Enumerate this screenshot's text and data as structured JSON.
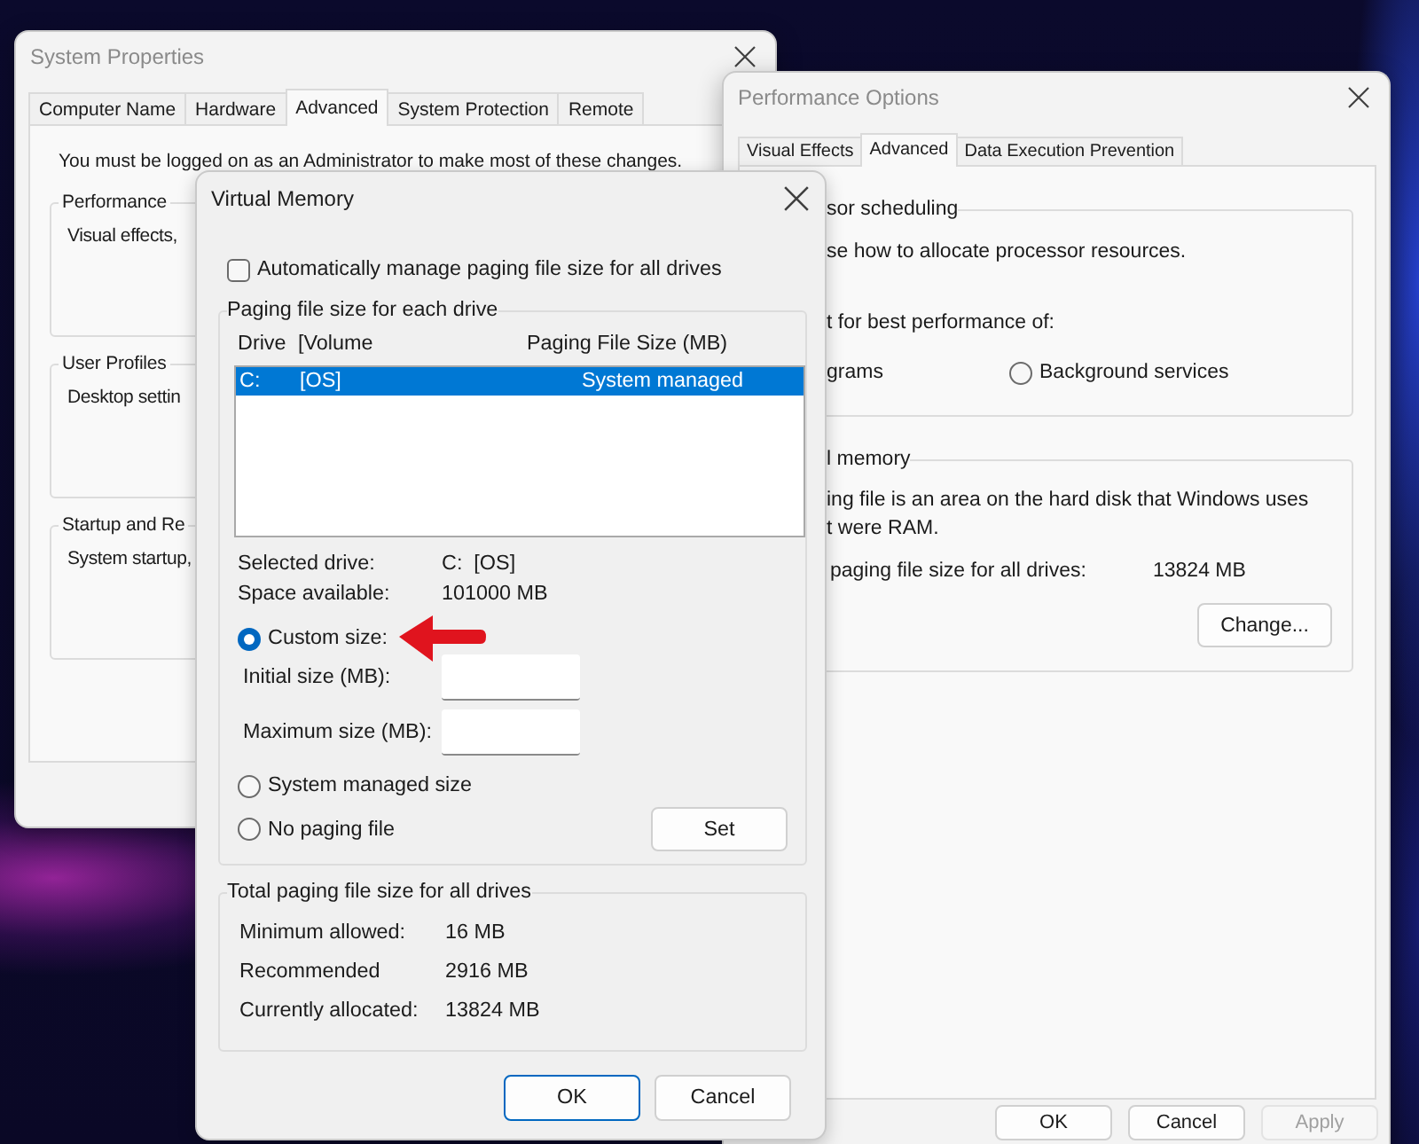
{
  "system_properties": {
    "title": "System Properties",
    "tabs": [
      {
        "label": "Computer Name",
        "selected": false
      },
      {
        "label": "Hardware",
        "selected": false
      },
      {
        "label": "Advanced",
        "selected": true
      },
      {
        "label": "System Protection",
        "selected": false
      },
      {
        "label": "Remote",
        "selected": false
      }
    ],
    "notice": "You must be logged on as an Administrator to make most of these changes.",
    "groups": [
      {
        "title": "Performance",
        "text": "Visual effects,"
      },
      {
        "title": "User Profiles",
        "text": "Desktop settin"
      },
      {
        "title": "Startup and Re",
        "text": "System startup,"
      }
    ]
  },
  "performance_options": {
    "title": "Performance Options",
    "tabs": [
      {
        "label": "Visual Effects",
        "selected": false
      },
      {
        "label": "Advanced",
        "selected": true
      },
      {
        "label": "Data Execution Prevention",
        "selected": false
      }
    ],
    "processor_scheduling": {
      "title": "sor scheduling",
      "description": "se how to allocate processor resources.",
      "adjust_label": "t for best performance of:",
      "programs_label": "grams",
      "background_option": {
        "label": "Background services",
        "selected": false
      }
    },
    "virtual_memory": {
      "title": "l memory",
      "description_lines": [
        "ing file is an area on the hard disk that Windows uses",
        "t were RAM."
      ],
      "total_label": "paging file size for all drives:",
      "total_value": "13824 MB",
      "change_button": "Change..."
    },
    "buttons": [
      {
        "label": "OK",
        "disabled": false
      },
      {
        "label": "Cancel",
        "disabled": false
      },
      {
        "label": "Apply",
        "disabled": true
      }
    ]
  },
  "virtual_memory_dialog": {
    "title": "Virtual Memory",
    "auto_manage": {
      "label": "Automatically manage paging file size for all drives",
      "checked": false
    },
    "drives_group": {
      "title": "Paging file size for each drive",
      "columns": [
        "Drive",
        "[Volume",
        "Paging File Size (MB)"
      ],
      "rows": [
        {
          "drive": "C:",
          "volume": "[OS]",
          "paging_size": "System managed",
          "selected": true
        }
      ],
      "details": [
        {
          "label": "Selected drive:",
          "value": "C:  [OS]"
        },
        {
          "label": "Space available:",
          "value": "101000 MB"
        }
      ],
      "size_options": [
        {
          "label": "Custom size:",
          "selected": true
        },
        {
          "label": "System managed size",
          "selected": false
        },
        {
          "label": "No paging file",
          "selected": false
        }
      ],
      "size_fields": [
        {
          "label": "Initial size (MB):"
        },
        {
          "label": "Maximum size (MB):"
        }
      ],
      "set_button": "Set"
    },
    "totals_group": {
      "title": "Total paging file size for all drives",
      "rows": [
        {
          "label": "Minimum allowed:",
          "value": "16 MB"
        },
        {
          "label": "Recommended",
          "value": "2916 MB"
        },
        {
          "label": "Currently allocated:",
          "value": "13824 MB"
        }
      ]
    },
    "buttons": [
      {
        "label": "OK",
        "default": true
      },
      {
        "label": "Cancel",
        "default": false
      }
    ]
  }
}
